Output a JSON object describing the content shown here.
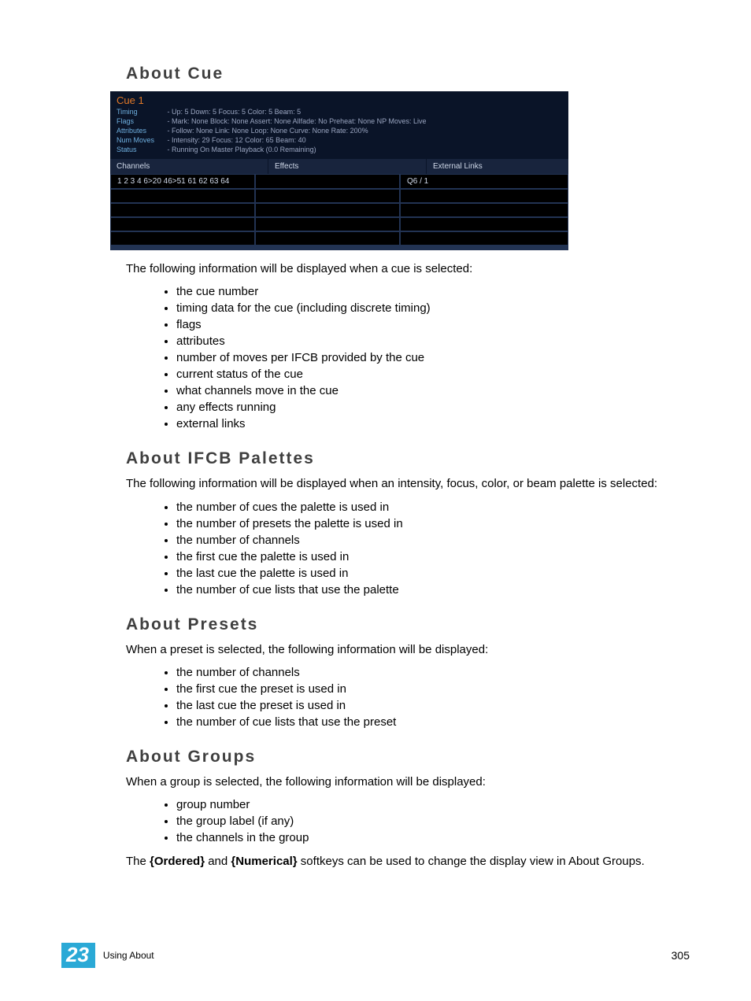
{
  "sections": {
    "cue": {
      "heading": "About Cue",
      "intro": "The following information will be displayed when a cue is selected:",
      "bullets": [
        "the cue number",
        "timing data for the cue (including discrete timing)",
        "flags",
        "attributes",
        "number of moves per IFCB provided by the cue",
        "current status of the cue",
        "what channels move in the cue",
        "any effects running",
        "external links"
      ]
    },
    "ifcb": {
      "heading": "About IFCB Palettes",
      "intro": "The following information will be displayed when an intensity, focus, color, or beam palette is selected:",
      "bullets": [
        "the number of cues the palette is used in",
        "the number of presets the palette is used in",
        "the number of channels",
        "the first cue the palette is used in",
        "the last cue the palette is used in",
        "the number of cue lists that use the palette"
      ]
    },
    "presets": {
      "heading": "About Presets",
      "intro": "When a preset is selected, the following information will be displayed:",
      "bullets": [
        "the number of channels",
        "the first cue the preset is used in",
        "the last cue the preset is used in",
        "the number of cue lists that use the preset"
      ]
    },
    "groups": {
      "heading": "About Groups",
      "intro": "When a group is selected, the following information will be displayed:",
      "bullets": [
        "group number",
        "the group label (if any)",
        "the channels in the group"
      ],
      "tail_pre": "The ",
      "tail_sk1": "{Ordered}",
      "tail_mid": " and ",
      "tail_sk2": "{Numerical}",
      "tail_post": " softkeys can be used to change the display view in About Groups."
    }
  },
  "screenshot": {
    "title": "Cue 1",
    "labels": {
      "timing": "Timing",
      "flags": "Flags",
      "attributes": "Attributes",
      "nummoves": "Num Moves",
      "status": "Status"
    },
    "lines": {
      "timing": "- Up: 5   Down: 5   Focus: 5   Color: 5   Beam: 5",
      "flags": "- Mark: None   Block: None   Assert: None   Allfade: No   Preheat: None   NP Moves: Live",
      "attributes": "- Follow: None   Link: None   Loop: None   Curve: None   Rate: 200%",
      "nummoves": "- Intensity: 29   Focus: 12   Color: 65   Beam: 40",
      "status": "- Running On Master Playback  (0.0 Remaining)"
    },
    "columns": {
      "channels": "Channels",
      "effects": "Effects",
      "external": "External Links"
    },
    "row0": {
      "channels": "1 2 3 4 6>20 46>51 61 62 63 64",
      "effects": "",
      "external": "Q6 / 1"
    }
  },
  "footer": {
    "chapter_num": "23",
    "chapter_title": "Using About",
    "page_num": "305"
  }
}
